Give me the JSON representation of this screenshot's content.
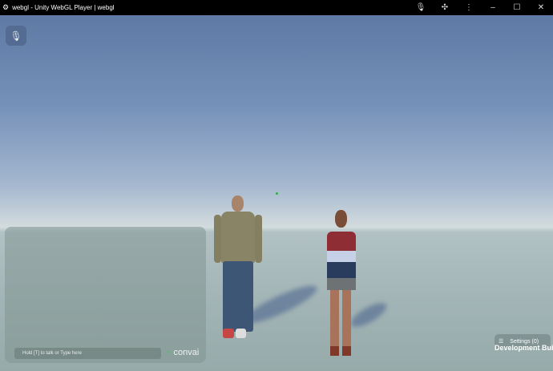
{
  "window": {
    "title": "webgl - Unity WebGL Player | webgl",
    "icons": [
      "unity-logo-icon",
      "microphone-icon",
      "extension-icon",
      "more-icon",
      "minimize-icon",
      "maximize-icon",
      "close-icon"
    ]
  },
  "scene": {
    "mic_button_icon": "microphone-icon"
  },
  "chat": {
    "input_placeholder": "Hold [T] to talk or Type here",
    "brand": "convai"
  },
  "settings": {
    "label": "Settings (0)",
    "icon": "sliders-icon"
  },
  "overlay": {
    "dev_build": "Development Build"
  }
}
